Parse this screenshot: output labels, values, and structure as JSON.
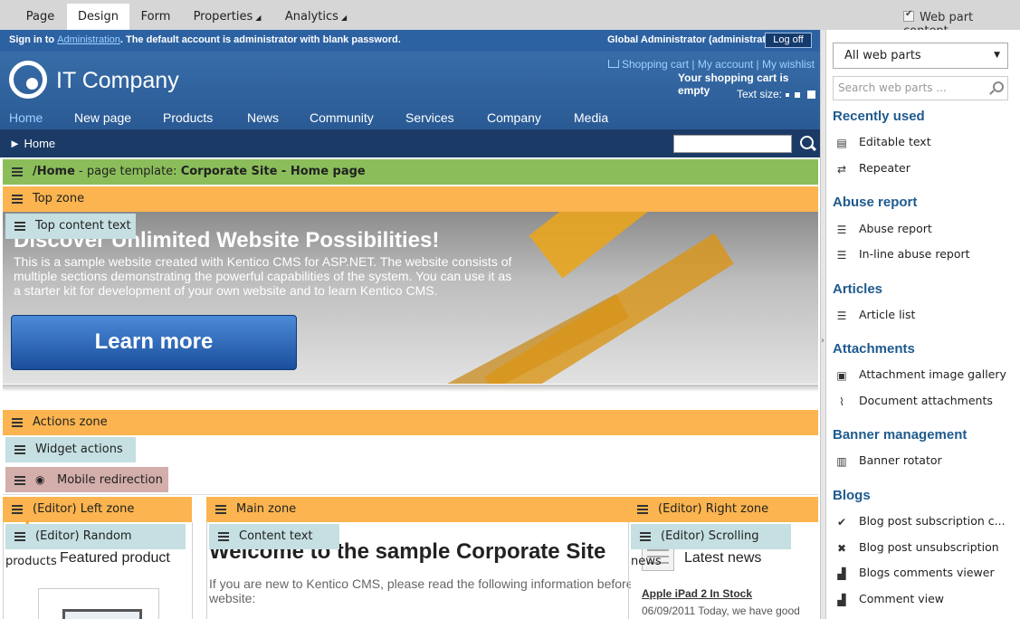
{
  "tabs": [
    {
      "label": "Page",
      "active": false,
      "has_arrow": false
    },
    {
      "label": "Design",
      "active": true,
      "has_arrow": false
    },
    {
      "label": "Form",
      "active": false,
      "has_arrow": false
    },
    {
      "label": "Properties",
      "active": false,
      "has_arrow": true
    },
    {
      "label": "Analytics",
      "active": false,
      "has_arrow": true
    }
  ],
  "web_part_content": {
    "label": "Web part content",
    "checked": true
  },
  "site": {
    "signin_prefix": "Sign in to ",
    "signin_link": "Administration",
    "signin_suffix": ". The default account is administrator with blank password.",
    "user": "Global Administrator (administrator)",
    "logoff": "Log off",
    "logo": "IT Company",
    "cart_links": "Shopping cart | My account | My wishlist",
    "cart_empty": "Your shopping cart is empty",
    "text_size": "Text size:",
    "nav": [
      "Home",
      "New page",
      "Products",
      "News",
      "Community",
      "Services",
      "Company",
      "Media"
    ],
    "breadcrumb": "► Home"
  },
  "template_bar": {
    "path": "/Home",
    "middle": " - page template: ",
    "template": "Corporate Site - Home page"
  },
  "zones": {
    "top": "Top zone",
    "top_content": "Top content text",
    "actions": "Actions zone",
    "widget_actions": "Widget actions",
    "mobile_redirection": "Mobile redirection",
    "left": "(Editor) Left zone",
    "random_products": "(Editor) Random products",
    "main": "Main zone",
    "content_text": "Content text",
    "right": "(Editor) Right zone",
    "scrolling_news": "(Editor) Scrolling news"
  },
  "banner": {
    "heading": "Discover Unlimited Website Possibilities!",
    "body": "This is a sample website created with Kentico CMS for ASP.NET. The website consists of multiple sections demonstrating the powerful capabilities of the system. You can use it as a starter kit for development of your own website and to learn Kentico CMS.",
    "button": "Learn more"
  },
  "content": {
    "featured": "Featured product",
    "welcome": "Welcome to the sample Corporate Site",
    "intro": "If you are new to Kentico CMS, please read the following information before",
    "intro2": "website:",
    "latest_news": "Latest news",
    "news_link": "Apple iPad 2 In Stock",
    "news_date": "06/09/2011 Today, we have good"
  },
  "panel": {
    "dropdown": "All web parts",
    "search_placeholder": "Search web parts ...",
    "categories": [
      {
        "title": "Recently used",
        "items": [
          {
            "label": "Editable text",
            "icon": "document-icon"
          },
          {
            "label": "Repeater",
            "icon": "repeat-icon"
          }
        ]
      },
      {
        "title": "Abuse report",
        "items": [
          {
            "label": "Abuse report",
            "icon": "list-icon"
          },
          {
            "label": "In-line abuse report",
            "icon": "list-icon"
          }
        ]
      },
      {
        "title": "Articles",
        "items": [
          {
            "label": "Article list",
            "icon": "list-icon"
          }
        ]
      },
      {
        "title": "Attachments",
        "items": [
          {
            "label": "Attachment image gallery",
            "icon": "image-icon"
          },
          {
            "label": "Document attachments",
            "icon": "paperclip-icon"
          }
        ]
      },
      {
        "title": "Banner management",
        "items": [
          {
            "label": "Banner rotator",
            "icon": "layers-icon"
          }
        ]
      },
      {
        "title": "Blogs",
        "items": [
          {
            "label": "Blog post subscription c...",
            "icon": "check-circle-icon"
          },
          {
            "label": "Blog post unsubscription",
            "icon": "x-circle-icon"
          },
          {
            "label": "Blogs comments viewer",
            "icon": "comments-icon"
          },
          {
            "label": "Comment view",
            "icon": "comments-icon"
          }
        ]
      }
    ]
  }
}
